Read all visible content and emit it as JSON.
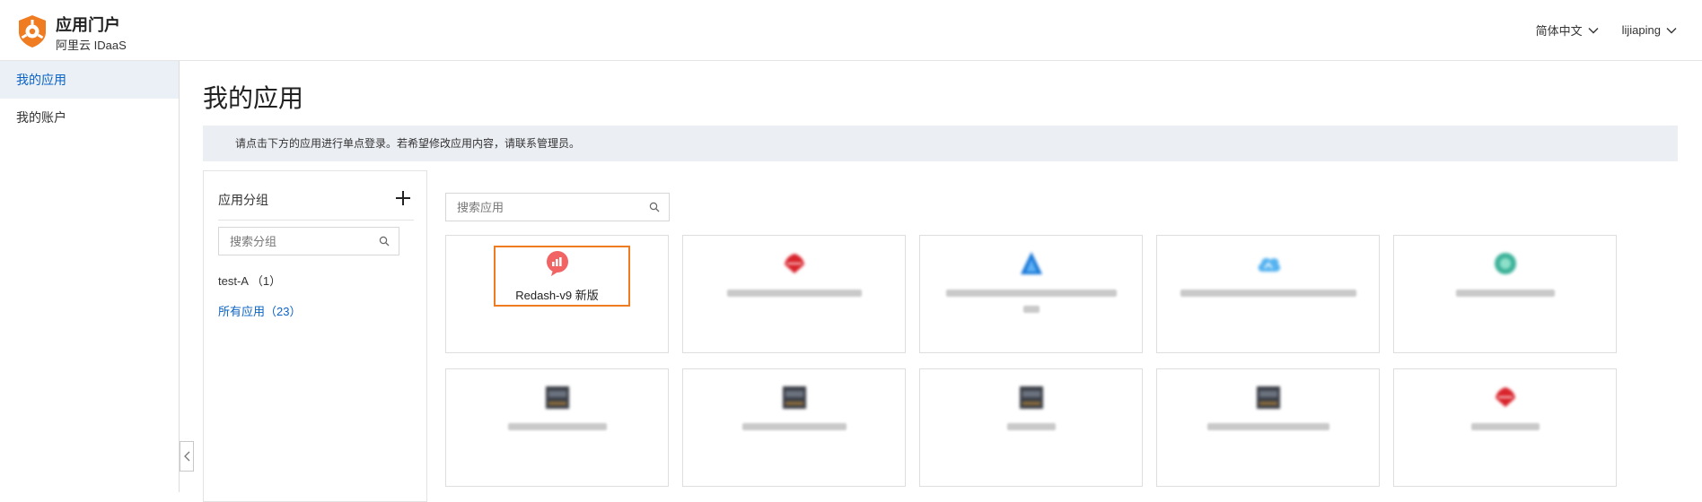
{
  "header": {
    "title": "应用门户",
    "subtitle": "阿里云 IDaaS",
    "language": "简体中文",
    "user": "lijiaping"
  },
  "sidebar": {
    "items": [
      {
        "label": "我的应用",
        "active": true
      },
      {
        "label": "我的账户",
        "active": false
      }
    ]
  },
  "main": {
    "title": "我的应用",
    "notice": "请点击下方的应用进行单点登录。若希望修改应用内容，请联系管理员。",
    "group_panel": {
      "title": "应用分组",
      "search_placeholder": "搜索分组",
      "groups": [
        {
          "label": "test-A （1）",
          "selected": false
        },
        {
          "label": "所有应用（23）",
          "selected": true
        }
      ]
    },
    "app_search_placeholder": "搜索应用",
    "apps": [
      {
        "name": "Redash-v9 新版",
        "icon": "redash-chart-bubble-icon",
        "color": "#f26363",
        "highlighted": true
      },
      {
        "name": "",
        "icon": "huawei-icon",
        "color": "#d9242c"
      },
      {
        "name": "",
        "icon": "azure-icon",
        "color": "#1877d8"
      },
      {
        "name": "",
        "icon": "cloud-icon",
        "color": "#56b3f0"
      },
      {
        "name": "",
        "icon": "gem-icon",
        "color": "#3fb39a"
      },
      {
        "name": "",
        "icon": "terminal-icon",
        "color": "#3b3f47"
      },
      {
        "name": "",
        "icon": "terminal-icon",
        "color": "#3b3f47"
      },
      {
        "name": "",
        "icon": "terminal-icon",
        "color": "#3b3f47"
      },
      {
        "name": "",
        "icon": "terminal-icon",
        "color": "#3b3f47"
      },
      {
        "name": "",
        "icon": "huawei-icon",
        "color": "#d9242c"
      }
    ]
  },
  "colors": {
    "accent": "#0b63c5",
    "logo": "#f07c22",
    "highlight_border": "#f07c22"
  }
}
